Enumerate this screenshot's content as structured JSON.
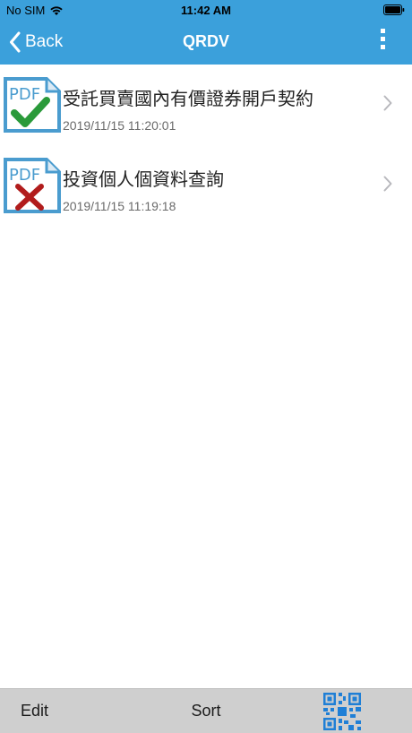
{
  "status_bar": {
    "carrier": "No SIM",
    "time": "11:42 AM",
    "icons": [
      "wifi-icon",
      "battery-icon"
    ]
  },
  "nav": {
    "back_label": "Back",
    "title": "QRDV",
    "more_icon": "more-vertical-icon",
    "accent_color": "#3ba0db"
  },
  "documents": [
    {
      "title": "受託買賣國內有價證券開戶契約",
      "timestamp": "2019/11/15 11:20:01",
      "status_icon": "pdf-signed-check-icon",
      "status_color": "#2a9a3a"
    },
    {
      "title": "投資個人個資料查詢",
      "timestamp": "2019/11/15 11:19:18",
      "status_icon": "pdf-rejected-x-icon",
      "status_color": "#b11c1c"
    }
  ],
  "toolbar": {
    "edit_label": "Edit",
    "sort_label": "Sort",
    "qr_icon": "qr-code-icon"
  }
}
